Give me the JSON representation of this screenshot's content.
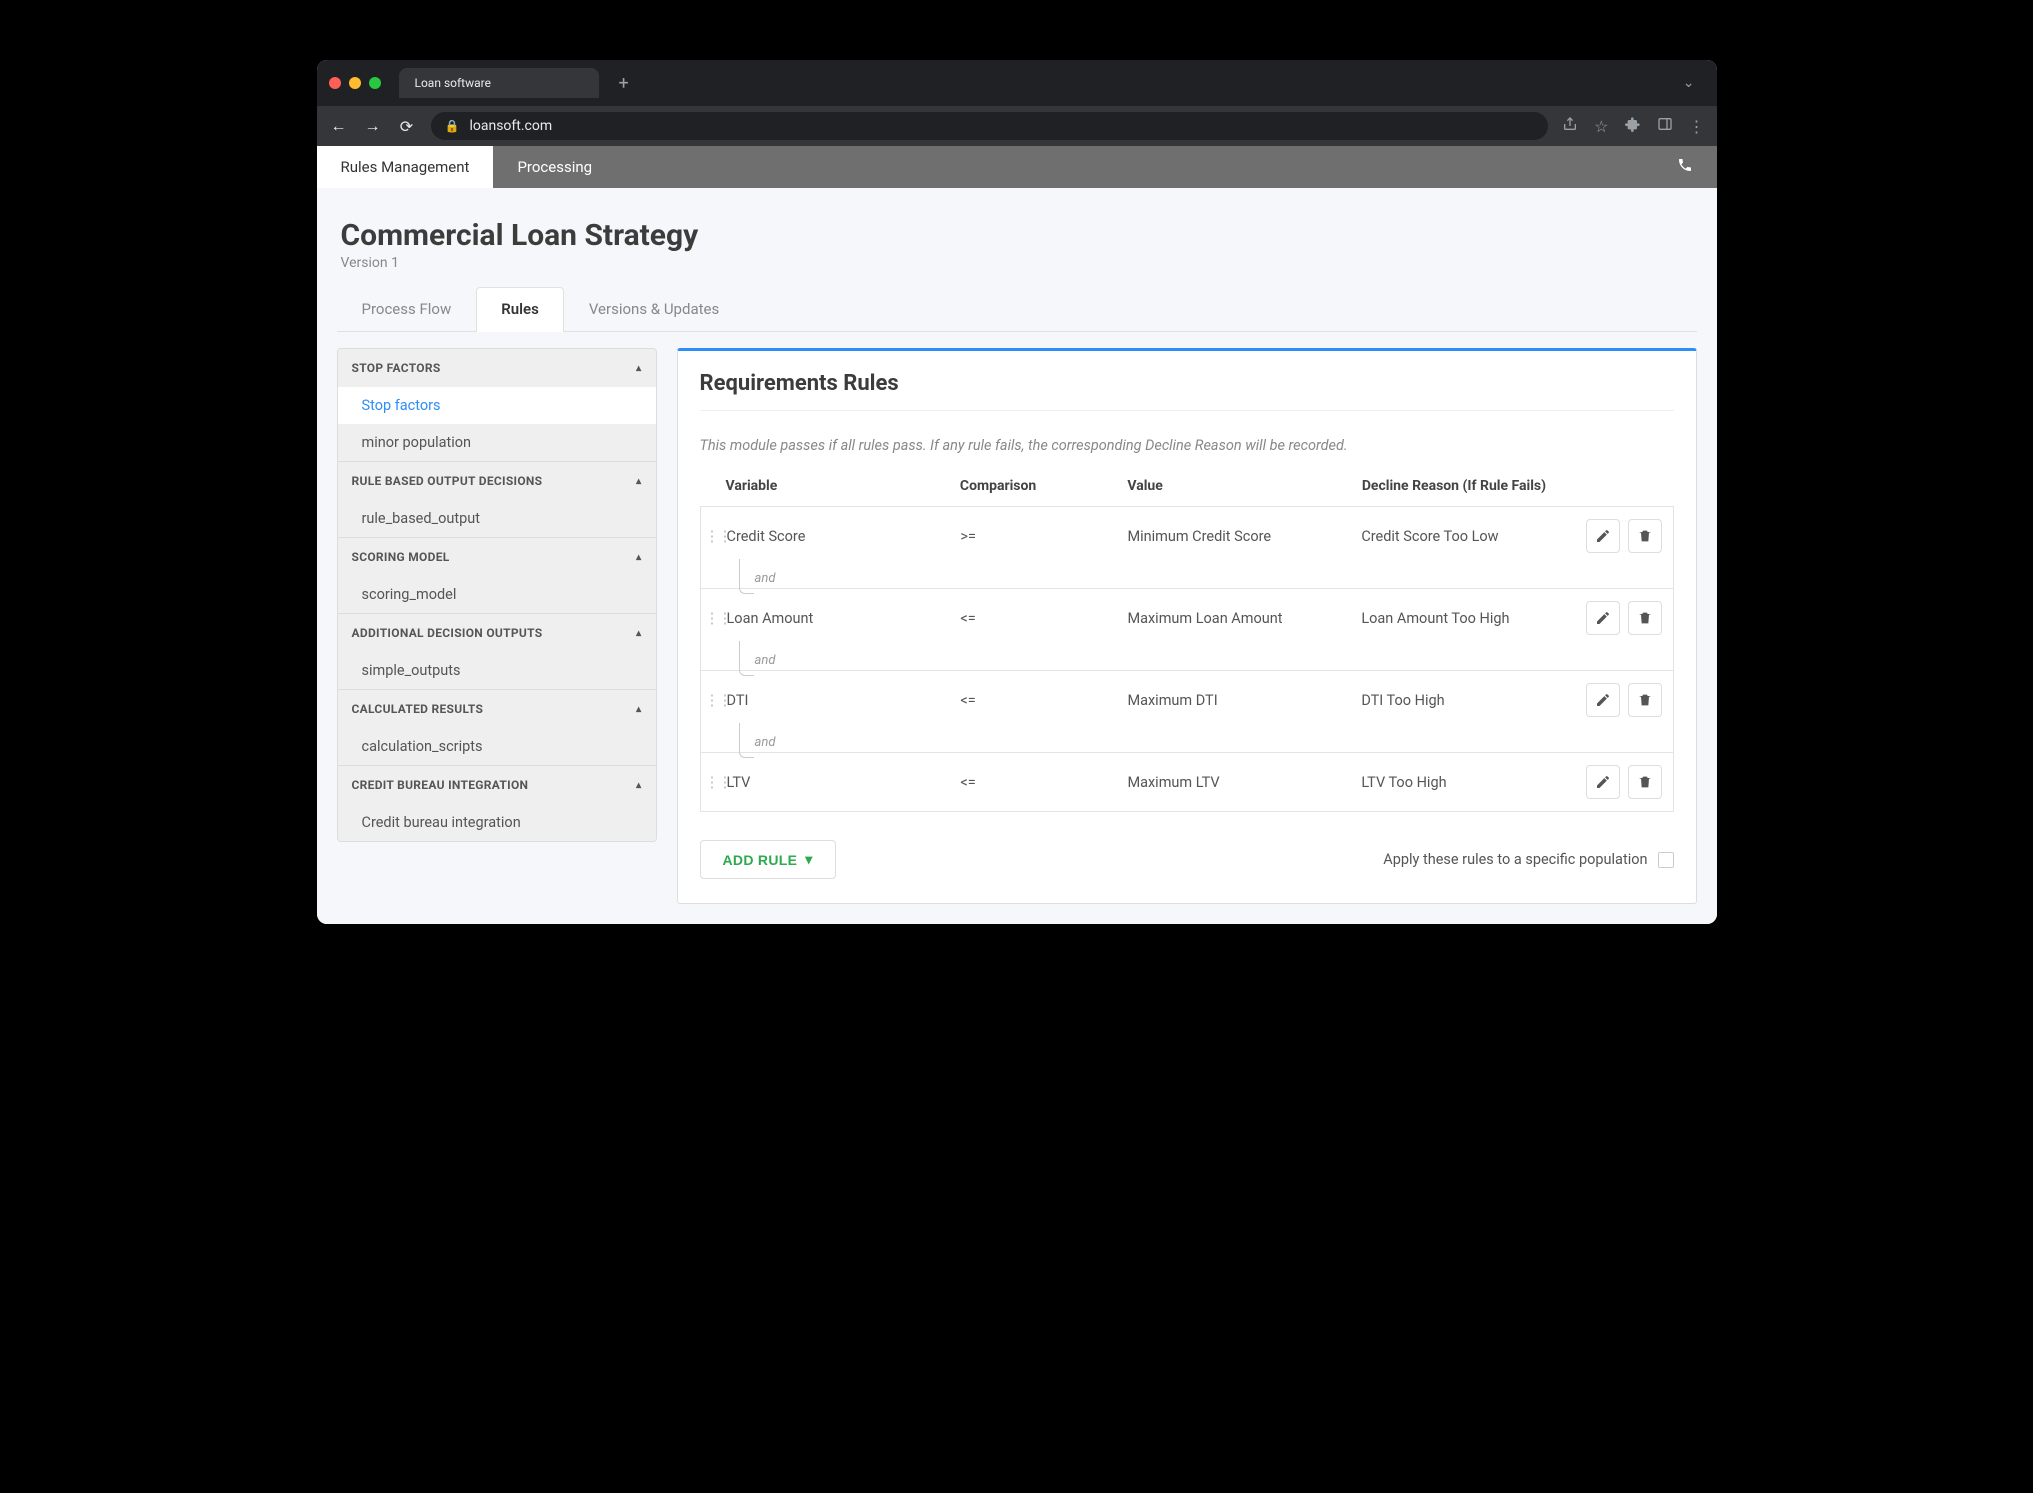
{
  "browser": {
    "tab_title": "Loan software",
    "url": "loansoft.com"
  },
  "appNav": {
    "tabs": [
      {
        "label": "Rules Management",
        "active": true
      },
      {
        "label": "Processing",
        "active": false
      }
    ]
  },
  "header": {
    "title": "Commercial Loan Strategy",
    "version": "Version 1"
  },
  "contentTabs": [
    {
      "label": "Process Flow",
      "active": false
    },
    {
      "label": "Rules",
      "active": true
    },
    {
      "label": "Versions & Updates",
      "active": false
    }
  ],
  "sidebar": [
    {
      "title": "STOP FACTORS",
      "items": [
        {
          "label": "Stop factors",
          "active": true
        },
        {
          "label": "minor population",
          "active": false
        }
      ]
    },
    {
      "title": "RULE BASED OUTPUT DECISIONS",
      "items": [
        {
          "label": "rule_based_output",
          "active": false
        }
      ]
    },
    {
      "title": "SCORING MODEL",
      "items": [
        {
          "label": "scoring_model",
          "active": false
        }
      ]
    },
    {
      "title": "ADDITIONAL DECISION OUTPUTS",
      "items": [
        {
          "label": "simple_outputs",
          "active": false
        }
      ]
    },
    {
      "title": "CALCULATED RESULTS",
      "items": [
        {
          "label": "calculation_scripts",
          "active": false
        }
      ]
    },
    {
      "title": "CREDIT BUREAU INTEGRATION",
      "items": [
        {
          "label": "Credit bureau integration",
          "active": false
        }
      ]
    }
  ],
  "panel": {
    "title": "Requirements Rules",
    "description": "This module passes if all rules pass. If any rule fails, the corresponding Decline Reason will be recorded.",
    "columns": {
      "variable": "Variable",
      "comparison": "Comparison",
      "value": "Value",
      "decline": "Decline Reason (If Rule Fails)"
    },
    "connector_label": "and",
    "rules": [
      {
        "variable": "Credit Score",
        "comparison": ">=",
        "value": "Minimum Credit Score",
        "decline": "Credit Score Too Low"
      },
      {
        "variable": "Loan Amount",
        "comparison": "<=",
        "value": "Maximum Loan Amount",
        "decline": "Loan Amount Too High"
      },
      {
        "variable": "DTI",
        "comparison": "<=",
        "value": "Maximum DTI",
        "decline": "DTI Too High"
      },
      {
        "variable": "LTV",
        "comparison": "<=",
        "value": "Maximum LTV",
        "decline": "LTV Too High"
      }
    ],
    "add_rule_label": "ADD RULE",
    "apply_population_label": "Apply these rules to a specific population"
  }
}
